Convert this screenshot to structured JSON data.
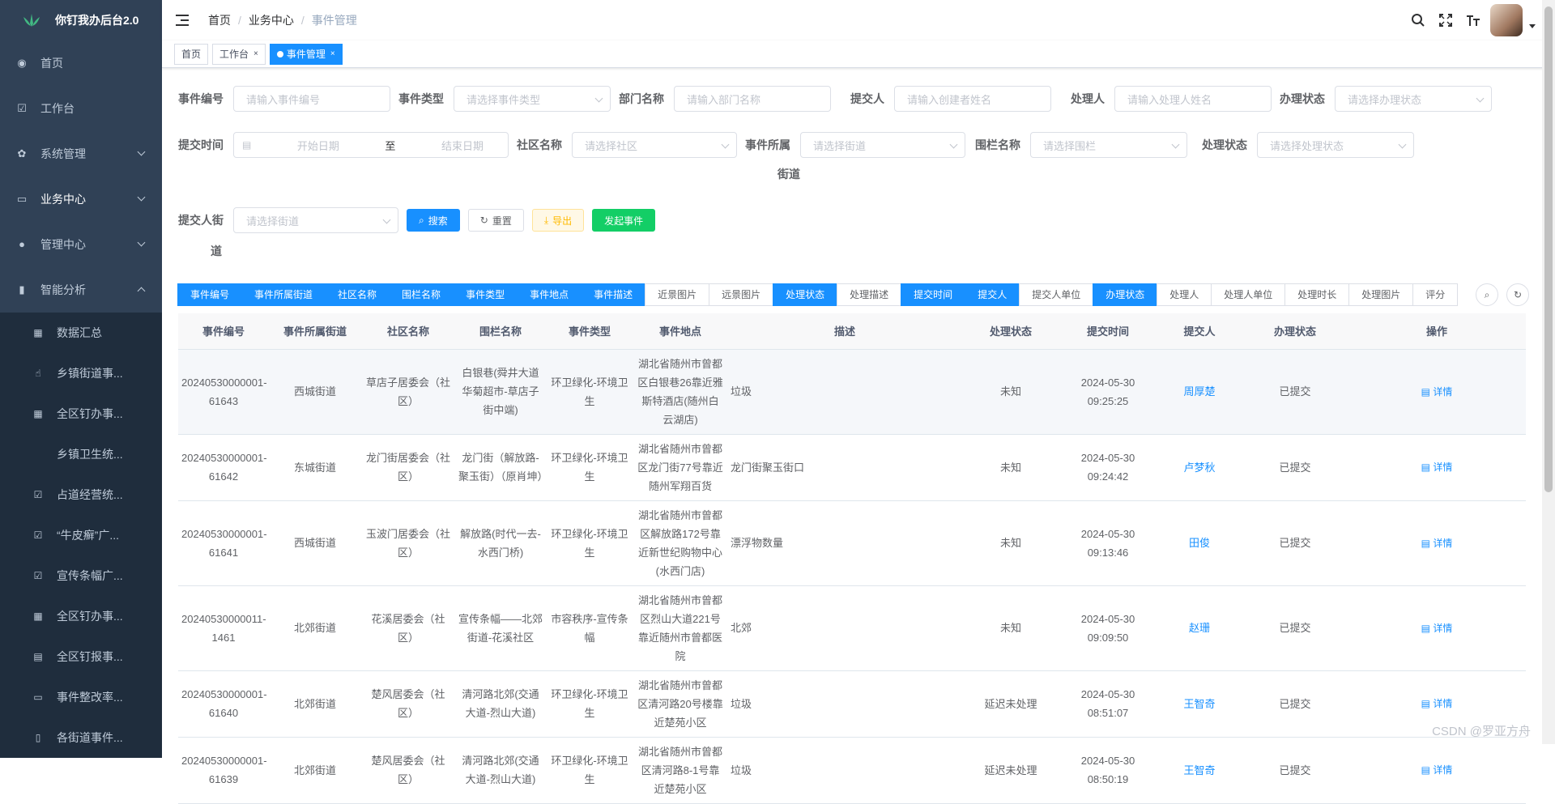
{
  "app": {
    "title": "你钉我办后台2.0"
  },
  "sidebar": {
    "items": [
      {
        "label": "首页",
        "icon": "dashboard-icon"
      },
      {
        "label": "工作台",
        "icon": "checkbox-icon"
      },
      {
        "label": "系统管理",
        "icon": "gear-icon"
      },
      {
        "label": "业务中心",
        "icon": "monitor-icon"
      },
      {
        "label": "管理中心",
        "icon": "user-icon"
      },
      {
        "label": "智能分析",
        "icon": "bar-chart-icon"
      }
    ],
    "subitems": [
      {
        "label": "数据汇总",
        "icon": "table-icon"
      },
      {
        "label": "乡镇街道事...",
        "icon": "thumb-icon"
      },
      {
        "label": "全区钉办事...",
        "icon": "table-icon"
      },
      {
        "label": "乡镇卫生统...",
        "icon": ""
      },
      {
        "label": "占道经营统...",
        "icon": "checkbox-icon"
      },
      {
        "label": "“牛皮癣”广...",
        "icon": "checkbox-icon"
      },
      {
        "label": "宣传条幅广...",
        "icon": "checkbox-icon"
      },
      {
        "label": "全区钉办事...",
        "icon": "table-icon"
      },
      {
        "label": "全区钉报事...",
        "icon": "form-icon"
      },
      {
        "label": "事件整改率...",
        "icon": "monitor-icon"
      },
      {
        "label": "各街道事件...",
        "icon": "book-icon"
      }
    ]
  },
  "breadcrumb": [
    "首页",
    "业务中心",
    "事件管理"
  ],
  "tags": [
    {
      "label": "首页",
      "closable": false
    },
    {
      "label": "工作台",
      "closable": true
    },
    {
      "label": "事件管理",
      "closable": true,
      "active": true
    }
  ],
  "filters": {
    "event_no": {
      "label": "事件编号",
      "placeholder": "请输入事件编号"
    },
    "event_type": {
      "label": "事件类型",
      "placeholder": "请选择事件类型"
    },
    "dept": {
      "label": "部门名称",
      "placeholder": "请输入部门名称"
    },
    "submitter": {
      "label": "提交人",
      "placeholder": "请输入创建者姓名"
    },
    "handler": {
      "label": "处理人",
      "placeholder": "请输入处理人姓名"
    },
    "status": {
      "label": "办理状态",
      "placeholder": "请选择办理状态"
    },
    "submit_time": {
      "label": "提交时间",
      "start": "开始日期",
      "sep": "至",
      "end": "结束日期"
    },
    "community": {
      "label": "社区名称",
      "placeholder": "请选择社区"
    },
    "street_line1": "事件所属",
    "street_line2": "街道",
    "street_placeholder": "请选择街道",
    "fence": {
      "label": "围栏名称",
      "placeholder": "请选择围栏"
    },
    "process_status": {
      "label": "处理状态",
      "placeholder": "请选择处理状态"
    },
    "submitter_street_line1": "提交人街",
    "submitter_street_line2": "道",
    "submitter_street_placeholder": "请选择街道"
  },
  "buttons": {
    "search": "搜索",
    "reset": "重置",
    "export": "导出",
    "create": "发起事件"
  },
  "columns_toggle": [
    {
      "label": "事件编号",
      "on": true
    },
    {
      "label": "事件所属街道",
      "on": true
    },
    {
      "label": "社区名称",
      "on": true
    },
    {
      "label": "围栏名称",
      "on": true
    },
    {
      "label": "事件类型",
      "on": true
    },
    {
      "label": "事件地点",
      "on": true
    },
    {
      "label": "事件描述",
      "on": true
    },
    {
      "label": "近景图片",
      "on": false
    },
    {
      "label": "远景图片",
      "on": false
    },
    {
      "label": "处理状态",
      "on": true
    },
    {
      "label": "处理描述",
      "on": false
    },
    {
      "label": "提交时间",
      "on": true
    },
    {
      "label": "提交人",
      "on": true
    },
    {
      "label": "提交人单位",
      "on": false
    },
    {
      "label": "办理状态",
      "on": true
    },
    {
      "label": "处理人",
      "on": false
    },
    {
      "label": "处理人单位",
      "on": false
    },
    {
      "label": "处理时长",
      "on": false
    },
    {
      "label": "处理图片",
      "on": false
    },
    {
      "label": "评分",
      "on": false
    }
  ],
  "table": {
    "headers": [
      "事件编号",
      "事件所属街道",
      "社区名称",
      "围栏名称",
      "事件类型",
      "事件地点",
      "描述",
      "处理状态",
      "提交时间",
      "提交人",
      "办理状态",
      "操作"
    ],
    "detail_label": "详情",
    "rows": [
      [
        "20240530000001-61643",
        "西城街道",
        "草店子居委会（社区）",
        "白银巷(舜井大道华菊超市-草店子街中端)",
        "环卫绿化-环境卫生",
        "湖北省随州市曾都区白银巷26靠近雅斯特酒店(随州白云湖店)",
        "垃圾",
        "未知",
        "2024-05-30 09:25:25",
        "周厚楚",
        "已提交"
      ],
      [
        "20240530000001-61642",
        "东城街道",
        "龙门街居委会（社区）",
        "龙门街（解放路-聚玉街）（原肖坤）",
        "环卫绿化-环境卫生",
        "湖北省随州市曾都区龙门街77号靠近随州军翔百货",
        "龙门街聚玉街口",
        "未知",
        "2024-05-30 09:24:42",
        "卢梦秋",
        "已提交"
      ],
      [
        "20240530000001-61641",
        "西城街道",
        "玉波门居委会（社区）",
        "解放路(时代一去-水西门桥)",
        "环卫绿化-环境卫生",
        "湖北省随州市曾都区解放路172号靠近新世纪购物中心(水西门店)",
        "漂浮物数量",
        "未知",
        "2024-05-30 09:13:46",
        "田俊",
        "已提交"
      ],
      [
        "20240530000011-1461",
        "北郊街道",
        "花溪居委会（社区）",
        "宣传条幅——北郊街道-花溪社区",
        "市容秩序-宣传条幅",
        "湖北省随州市曾都区烈山大道221号靠近随州市曾都医院",
        "北郊",
        "未知",
        "2024-05-30 09:09:50",
        "赵珊",
        "已提交"
      ],
      [
        "20240530000001-61640",
        "北郊街道",
        "楚风居委会（社区）",
        "清河路北郊(交通大道-烈山大道)",
        "环卫绿化-环境卫生",
        "湖北省随州市曾都区清河路20号楼靠近楚苑小区",
        "垃圾",
        "延迟未处理",
        "2024-05-30 08:51:07",
        "王智奇",
        "已提交"
      ],
      [
        "20240530000001-61639",
        "北郊街道",
        "楚风居委会（社区）",
        "清河路北郊(交通大道-烈山大道)",
        "环卫绿化-环境卫生",
        "湖北省随州市曾都区清河路8-1号靠近楚苑小区",
        "垃圾",
        "延迟未处理",
        "2024-05-30 08:50:19",
        "王智奇",
        "已提交"
      ]
    ]
  },
  "watermark": "CSDN @罗亚方舟",
  "colors": {
    "primary": "#1890ff",
    "sidebar": "#304156",
    "success": "#13ce66",
    "warning": "#ffba00"
  }
}
